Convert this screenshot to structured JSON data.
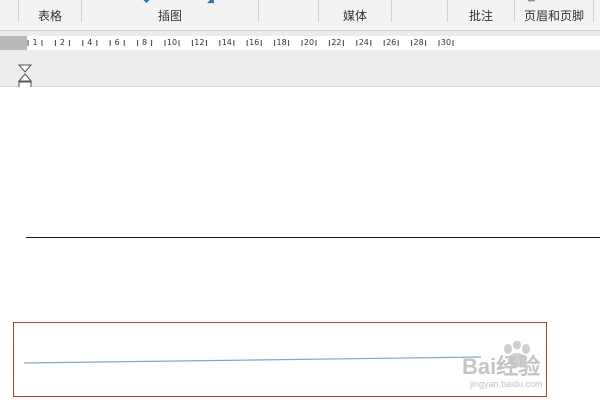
{
  "ribbon": {
    "groups": [
      {
        "label": "表格"
      },
      {
        "label": "插图"
      },
      {
        "label": "媒体"
      },
      {
        "label": "批注"
      },
      {
        "label": "页眉和页脚"
      }
    ]
  },
  "ruler": {
    "labels": [
      "1",
      "2",
      "4",
      "6",
      "8",
      "10",
      "12",
      "14",
      "16",
      "18",
      "20",
      "22",
      "24",
      "26",
      "28",
      "30"
    ]
  },
  "watermark": {
    "brand": "Bai经验",
    "url": "jingyan.baidu.com"
  },
  "colors": {
    "highlight_border": "#c8373d",
    "inserted_line": "#7fa8cf",
    "ribbon_bg": "#f3f3f3"
  }
}
